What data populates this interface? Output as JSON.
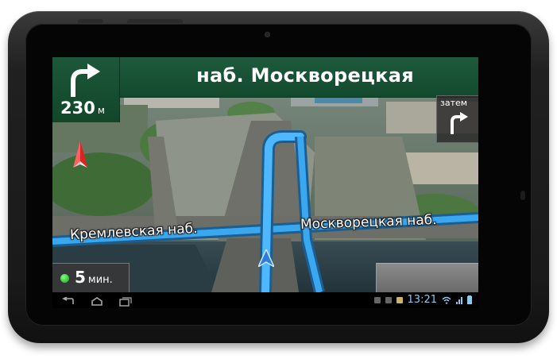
{
  "navigation": {
    "street_name": "наб. Москворецкая",
    "distance_value": "230",
    "distance_unit": "м",
    "then_label": "затем",
    "then_turn": "right",
    "current_turn": "right"
  },
  "map_labels": {
    "left_road": "Кремлевская наб.",
    "right_road": "Москворецкая наб."
  },
  "eta": {
    "value": "5",
    "unit": "мин."
  },
  "status_bar": {
    "time": "13:21"
  },
  "icons": [
    "turn-right-arrow-icon",
    "then-turn-right-icon",
    "compass-icon",
    "position-arrow-icon",
    "back-icon",
    "home-icon",
    "recent-apps-icon",
    "wifi-icon",
    "signal-icon",
    "battery-icon"
  ],
  "colors": {
    "banner_green": "#1a5236",
    "route_blue": "#39a8f0",
    "eta_dot": "#2ecc40",
    "clock_blue": "#8ec8f0"
  }
}
